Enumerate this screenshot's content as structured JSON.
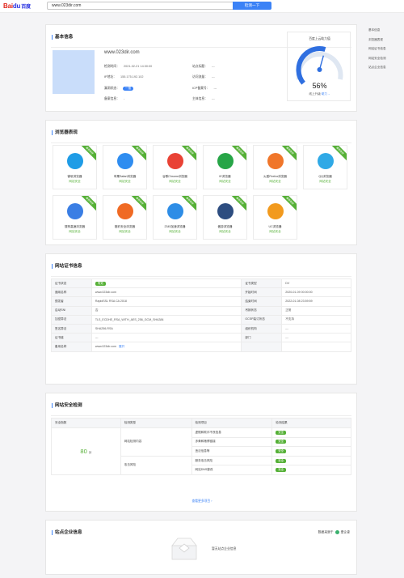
{
  "header": {
    "logo_bai": "Bai",
    "logo_du": "du",
    "logo_cn": "百度",
    "search_value": "www.023dir.com",
    "search_button": "检测一下"
  },
  "sidenav": {
    "items": [
      "基本信息",
      "浏览器表现",
      "网站证书信息",
      "网站安全检测",
      "站点企业信息"
    ]
  },
  "basic": {
    "title": "基本信息",
    "domain": "www.023dir.com",
    "fields": [
      {
        "k": "检测时间：",
        "v": "2021-02-21 14:30:00"
      },
      {
        "k": "IP地址：",
        "v": "155.175.192.102"
      },
      {
        "k": "漏洞状态：",
        "v": "一般",
        "pill": true
      },
      {
        "k": "备案信息：",
        "v": "-"
      },
      {
        "k": "站点标题：",
        "v": "---"
      },
      {
        "k": "访问流量：",
        "v": "---"
      },
      {
        "k": "ICP备案号：",
        "v": "---"
      },
      {
        "k": "主体信息：",
        "v": "---"
      }
    ],
    "gauge": {
      "title": "百度上云助力值",
      "percent": "56%",
      "value": 56,
      "sub_text": "线上升级",
      "sub_link": "助力→"
    }
  },
  "browsers": {
    "title": "浏览器表现",
    "ribbon": "兼容良好",
    "items": [
      {
        "name": "微软浏览器",
        "status": "网站安全",
        "icon": "edge-icon",
        "color": "#1f9ce6"
      },
      {
        "name": "苹果Safari浏览器",
        "status": "网站安全",
        "icon": "safari-icon",
        "color": "#2f8df0"
      },
      {
        "name": "谷歌Chrome浏览器",
        "status": "网站安全",
        "icon": "chrome-icon",
        "color": "#e94235"
      },
      {
        "name": "IE浏览器",
        "status": "网站安全",
        "icon": "ie-icon",
        "color": "#27a547"
      },
      {
        "name": "火狐Firefox浏览器",
        "status": "网站安全",
        "icon": "firefox-icon",
        "color": "#f0762a"
      },
      {
        "name": "QQ浏览器",
        "status": "网站安全",
        "icon": "qq-browser-icon",
        "color": "#2fa9e6"
      },
      {
        "name": "搜狗高速浏览器",
        "status": "网站安全",
        "icon": "sogou-icon",
        "color": "#3a7ee4"
      },
      {
        "name": "猎豹安全浏览器",
        "status": "网站安全",
        "icon": "liebao-icon",
        "color": "#f06a24"
      },
      {
        "name": "2345加速浏览器",
        "status": "网站安全",
        "icon": "2345-icon",
        "color": "#2e8de6"
      },
      {
        "name": "傲游浏览器",
        "status": "网站安全",
        "icon": "maxthon-icon",
        "color": "#2d4d80"
      },
      {
        "name": "UC浏览器",
        "status": "网站安全",
        "icon": "uc-icon",
        "color": "#f29a1e"
      }
    ]
  },
  "cert": {
    "title": "网站证书信息",
    "rows": [
      {
        "k1": "证书状态",
        "v1": "有效",
        "v1_pill": true,
        "k2": "证书类型",
        "v2": "DV"
      },
      {
        "k1": "通用名称",
        "v1": "www.023dir.com",
        "k2": "开始时间",
        "v2": "2020-01-09 00:00:00"
      },
      {
        "k1": "颁发者",
        "v1": "RapidSSL RSA CA 2018",
        "k2": "结束时间",
        "v2": "2022-01-08 23:59:59"
      },
      {
        "k1": "启动SNI",
        "v1": "否",
        "k2": "吊销状态",
        "v2": "正常"
      },
      {
        "k1": "加密算法",
        "v1": "TLS_ECDHE_RSA_WITH_AES_256_GCM_SHA384",
        "k2": "OCSP装订状态",
        "v2": "不支持"
      },
      {
        "k1": "签名算法",
        "v1": "SHA256-RSA",
        "k2": "组织机构",
        "v2": "---"
      },
      {
        "k1": "证书链",
        "v1": "---",
        "k2": "部门",
        "v2": "---"
      },
      {
        "k1": "备用名称",
        "v1": "www.023dir.com",
        "v1_link": "展开",
        "k2": "",
        "v2": ""
      }
    ]
  },
  "security": {
    "title": "网站安全检测",
    "headers": [
      "安全指数",
      "检测类型",
      "检测项目",
      "检测结果"
    ],
    "score": "80",
    "score_unit": "分",
    "groups": [
      {
        "type": "网站检测内容",
        "items": [
          {
            "name": "虚假和欺诈不良信息",
            "result": "安全"
          },
          {
            "name": "涉黄和赌博链接",
            "result": "安全"
          },
          {
            "name": "违法信息等",
            "result": "安全"
          }
        ]
      },
      {
        "type": "攻击风险",
        "items": [
          {
            "name": "服务攻击风险",
            "result": "安全"
          },
          {
            "name": "网站DNS篡改",
            "result": "安全"
          }
        ]
      }
    ],
    "more": "查看更多项目 ›"
  },
  "enterprise": {
    "title": "站点企业信息",
    "source_prefix": "数据来源于",
    "source_name": "爱企查",
    "empty_text": "暂无站点企业信息"
  },
  "colors": {
    "accent": "#3b82f6",
    "safe": "#55b036",
    "brand_red": "#e1251b"
  }
}
